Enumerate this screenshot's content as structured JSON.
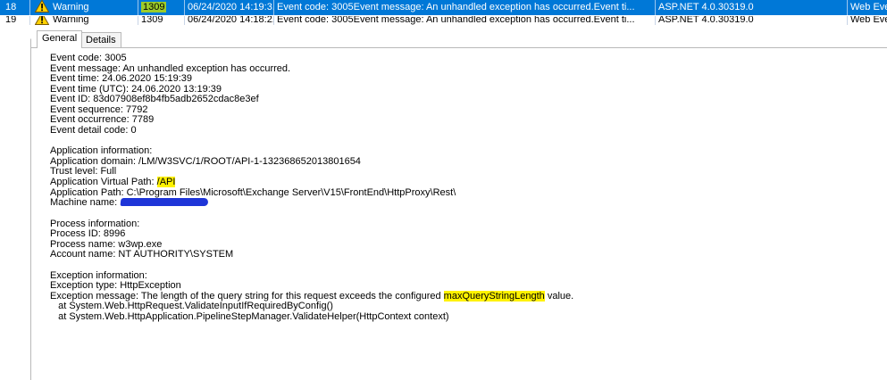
{
  "event_list": {
    "rows": [
      {
        "num": "18",
        "level": "Warning",
        "event_id": "1309",
        "datetime": "06/24/2020 14:19:3...",
        "message": "Event code: 3005Event message: An unhandled exception has occurred.Event ti...",
        "source": "ASP.NET 4.0.30319.0",
        "category": "Web Eve"
      },
      {
        "num": "19",
        "level": "Warning",
        "event_id": "1309",
        "datetime": "06/24/2020 14:18:2...",
        "message": "Event code: 3005Event message: An unhandled exception has occurred.Event ti...",
        "source": "ASP.NET 4.0.30319.0",
        "category": "Web Eve"
      }
    ]
  },
  "tabs": {
    "general": "General",
    "details": "Details"
  },
  "detail": {
    "event_info": [
      "Event code: 3005",
      "Event message: An unhandled exception has occurred.",
      "Event time: 24.06.2020 15:19:39",
      "Event time (UTC): 24.06.2020 13:19:39",
      "Event ID: 83d07908ef8b4fb5adb2652cdac8e3ef",
      "Event sequence: 7792",
      "Event occurrence: 7789",
      "Event detail code: 0"
    ],
    "app_header": "Application information:",
    "app_domain": "Application domain: /LM/W3SVC/1/ROOT/API-1-132368652013801654",
    "trust_level": "Trust level: Full",
    "virtual_path_label": "Application Virtual Path: ",
    "virtual_path_value": "/API",
    "app_path": "Application Path: C:\\Program Files\\Microsoft\\Exchange Server\\V15\\FrontEnd\\HttpProxy\\Rest\\",
    "machine_label": "Machine name: ",
    "process_info": [
      "Process information:",
      "Process ID: 8996",
      "Process name: w3wp.exe",
      "Account name: NT AUTHORITY\\SYSTEM"
    ],
    "exception_header": "Exception information:",
    "exception_type": "Exception type: HttpException",
    "exception_msg_before": "Exception message: The length of the query string for this request exceeds the configured ",
    "exception_msg_highlight": "maxQueryStringLength",
    "exception_msg_after": " value.",
    "stack": [
      "   at System.Web.HttpRequest.ValidateInputIfRequiredByConfig()",
      "   at System.Web.HttpApplication.PipelineStepManager.ValidateHelper(HttpContext context)"
    ]
  },
  "colors": {
    "selection": "#0078d7",
    "highlight_yellow": "#fff200",
    "highlight_green": "#9ccc2a",
    "redaction": "#1e35d8"
  }
}
